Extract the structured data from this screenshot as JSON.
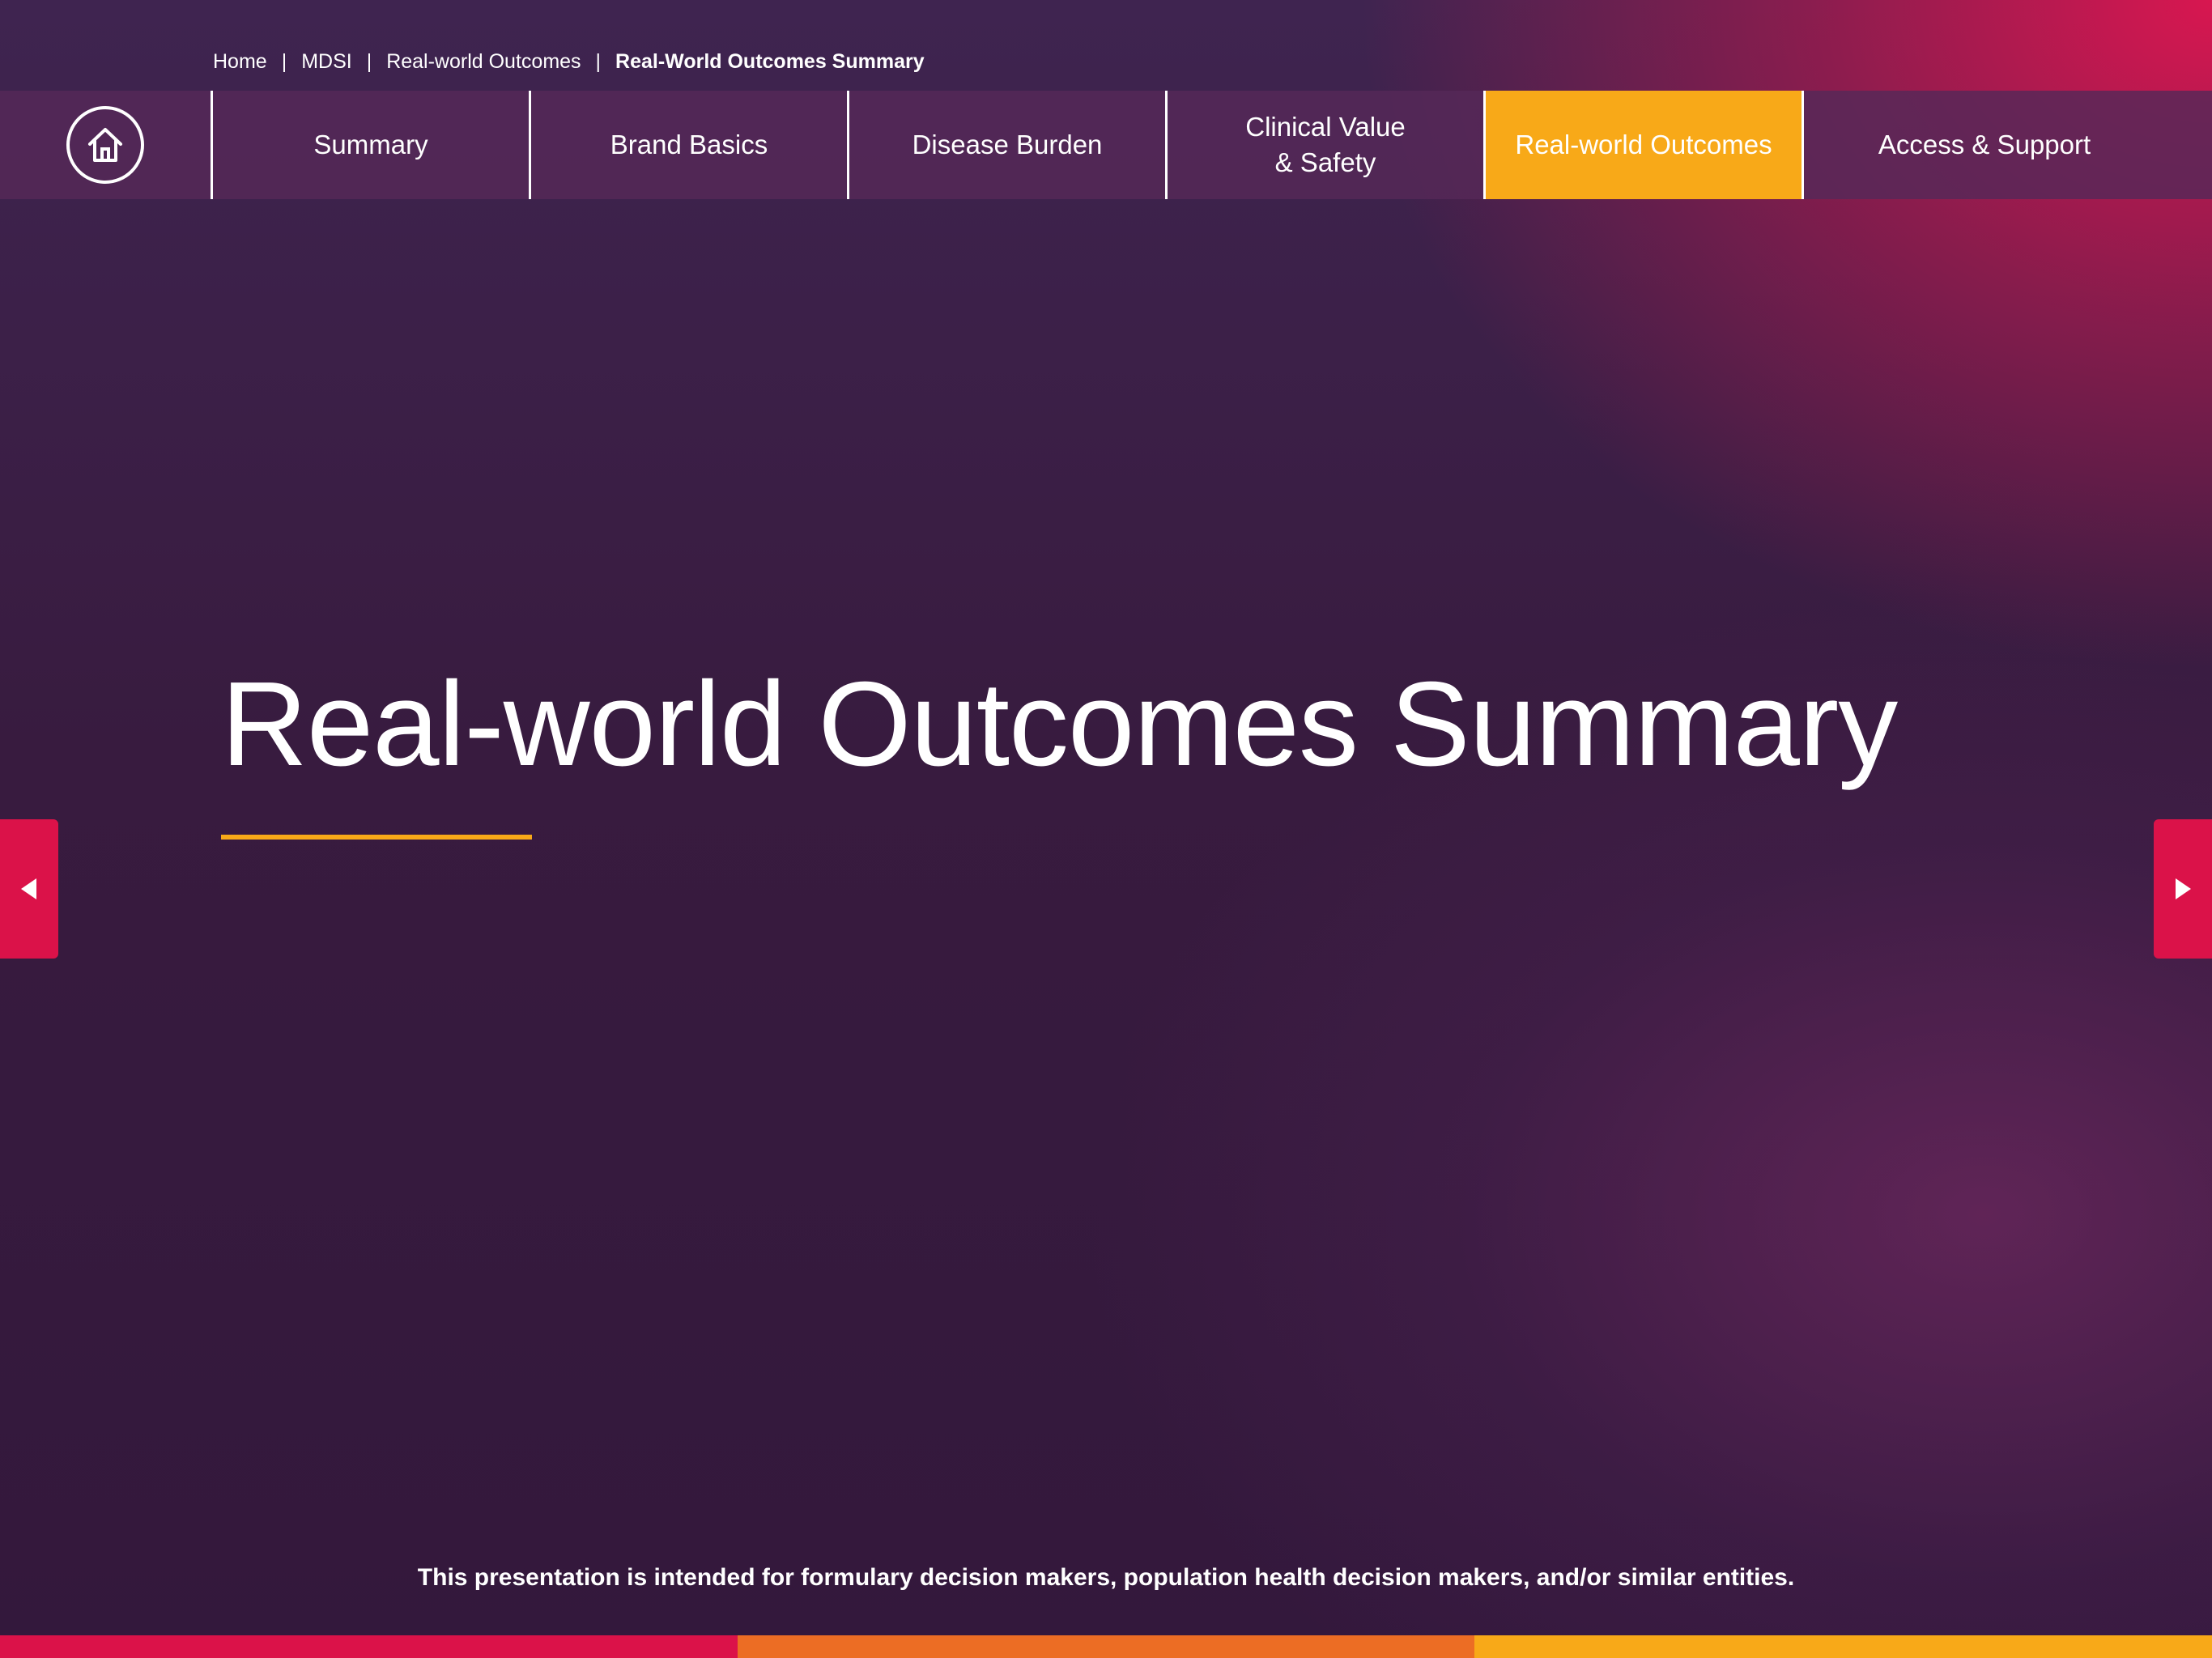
{
  "breadcrumb": {
    "items": [
      "Home",
      "MDSI",
      "Real-world Outcomes",
      "Real-World Outcomes Summary"
    ],
    "separator": "|"
  },
  "nav": {
    "home_icon": "home-icon",
    "tabs": [
      {
        "label": "Summary"
      },
      {
        "label": "Brand Basics"
      },
      {
        "label": "Disease Burden"
      },
      {
        "label": "Clinical Value\n& Safety"
      },
      {
        "label": "Real-world Outcomes",
        "active": true
      },
      {
        "label": "Access & Support"
      }
    ]
  },
  "main": {
    "title": "Real-world Outcomes Summary",
    "disclaimer": "This presentation is intended for formulary decision makers, population health decision makers, and/or similar entities."
  },
  "controls": {
    "prev_icon": "triangle-left-icon",
    "next_icon": "triangle-right-icon"
  },
  "colors": {
    "accent_orange": "#f8a918",
    "accent_red": "#db1249",
    "bar_orange": "#ec6d24",
    "nav_bg": "#562858",
    "background_dark": "#33183c"
  }
}
